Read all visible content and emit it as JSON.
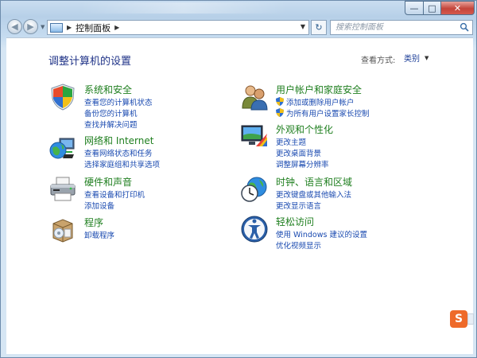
{
  "window": {
    "minimize_glyph": "—",
    "maximize_glyph": "□",
    "close_glyph": "✕"
  },
  "nav": {
    "back_glyph": "◀",
    "forward_glyph": "▶",
    "address_text": "控制面板",
    "breadcrumb_sep": "▶",
    "refresh_glyph": "↻",
    "search_placeholder": "搜索控制面板"
  },
  "content": {
    "heading": "调整计算机的设置",
    "view_by_label": "查看方式:",
    "view_by_value": "类别"
  },
  "categories": [
    {
      "id": "system-security",
      "title": "系统和安全",
      "links": [
        "查看您的计算机状态",
        "备份您的计算机",
        "查找并解决问题"
      ]
    },
    {
      "id": "network-internet",
      "title": "网络和 Internet",
      "links": [
        "查看网络状态和任务",
        "选择家庭组和共享选项"
      ]
    },
    {
      "id": "hardware-sound",
      "title": "硬件和声音",
      "links": [
        "查看设备和打印机",
        "添加设备"
      ]
    },
    {
      "id": "programs",
      "title": "程序",
      "links": [
        "卸载程序"
      ]
    },
    {
      "id": "user-accounts",
      "title": "用户帐户和家庭安全",
      "links": [
        "添加或删除用户帐户",
        "为所有用户设置家长控制"
      ]
    },
    {
      "id": "appearance",
      "title": "外观和个性化",
      "links": [
        "更改主题",
        "更改桌面背景",
        "调整屏幕分辨率"
      ]
    },
    {
      "id": "clock-language",
      "title": "时钟、语言和区域",
      "links": [
        "更改键盘或其他输入法",
        "更改显示语言"
      ]
    },
    {
      "id": "ease-of-access",
      "title": "轻松访问",
      "links": [
        "使用 Windows 建议的设置",
        "优化视频显示"
      ]
    }
  ],
  "ime": {
    "badge_text": "S"
  },
  "colors": {
    "heading": "#1e3287",
    "category_title": "#1f7f1f",
    "link": "#1a4ab0"
  }
}
